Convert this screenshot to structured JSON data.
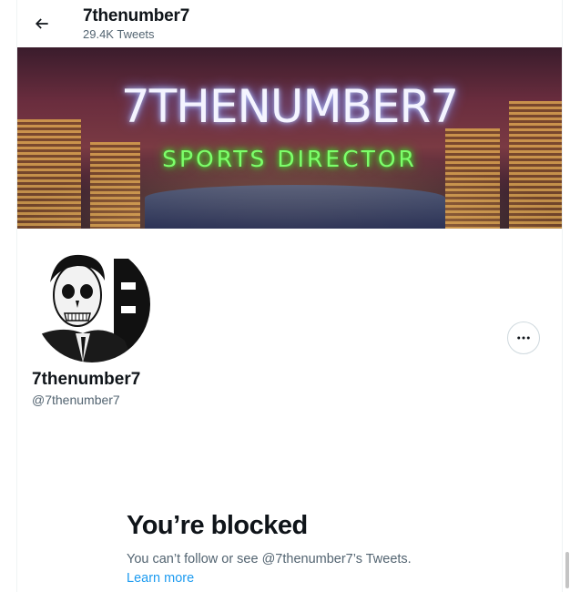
{
  "header": {
    "name": "7thenumber7",
    "tweet_count": "29.4K Tweets"
  },
  "banner": {
    "title": "7THENUMBER7",
    "subtitle": "SPORTS DIRECTOR"
  },
  "profile": {
    "name": "7thenumber7",
    "handle": "@7thenumber7"
  },
  "blocked": {
    "title": "You’re blocked",
    "message": "You can’t follow or see @7thenumber7’s Tweets.",
    "learn_more": "Learn more"
  },
  "colors": {
    "accent": "#1d9bf0",
    "text": "#0f1419",
    "secondary_text": "#536471",
    "border": "#eff3f4"
  },
  "icons": {
    "back": "arrow-left-icon",
    "more": "more-horizontal-icon"
  }
}
